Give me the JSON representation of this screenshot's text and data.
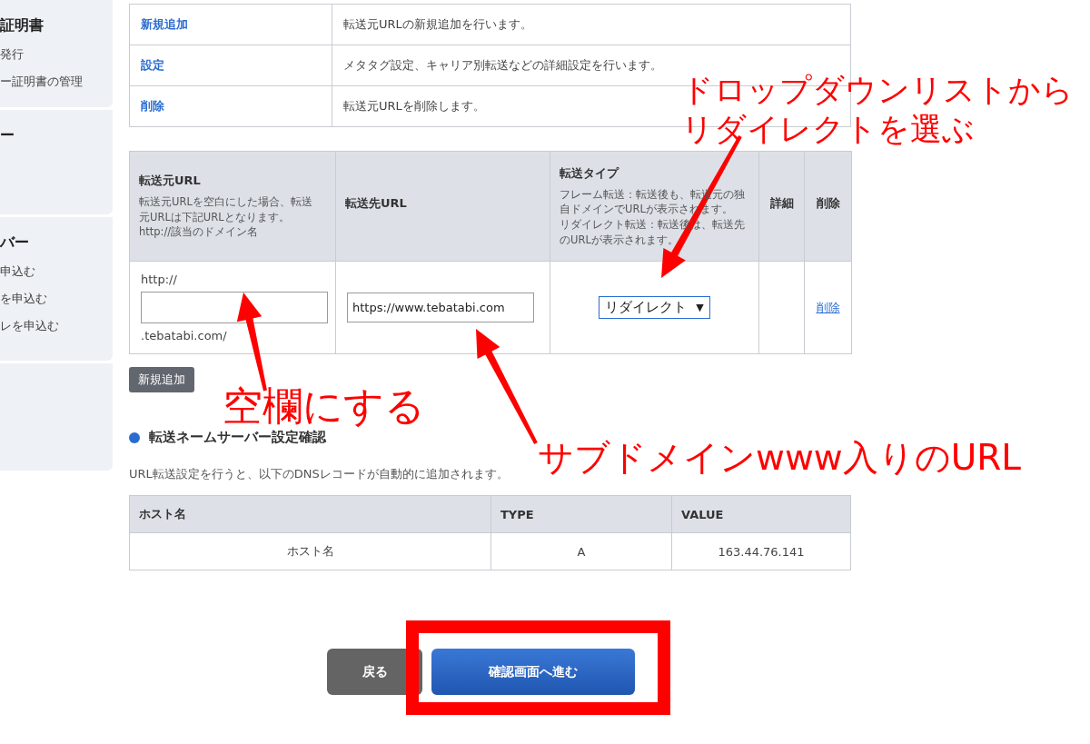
{
  "sidebar": {
    "cards": [
      {
        "title": "証明書",
        "items": [
          "発行",
          "ー証明書の管理"
        ]
      },
      {
        "title": "ー"
      },
      {
        "title": "バー",
        "items": [
          "申込む",
          "を申込む",
          "レを申込む"
        ]
      }
    ]
  },
  "action_table": {
    "rows": [
      {
        "action": "新規追加",
        "description": "転送元URLの新規追加を行います。"
      },
      {
        "action": "設定",
        "description": "メタタグ設定、キャリア別転送などの詳細設定を行います。"
      },
      {
        "action": "削除",
        "description": "転送元URLを削除します。"
      }
    ]
  },
  "forward_table": {
    "columns": [
      {
        "title": "転送元URL",
        "note": [
          "転送元URLを空白にした場合、転送",
          "元URLは下記URLとなります。",
          "http://該当のドメイン名"
        ]
      },
      {
        "title": "転送先URL"
      },
      {
        "title": "転送タイプ",
        "note": [
          "フレーム転送：転送後も、転送元の独",
          "自ドメインでURLが表示されます。",
          "リダイレクト転送：転送後は、転送先",
          "のURLが表示されます。"
        ]
      },
      {
        "title": "詳細"
      },
      {
        "title": "削除"
      }
    ],
    "rows": [
      {
        "prefix": "http://",
        "suffix": ".tebatabi.com/",
        "target_value": "https://www.tebatabi.com",
        "type": "リダイレクト",
        "type_arrow": "▼",
        "delete": "削除"
      }
    ]
  },
  "add_button": "新規追加",
  "dns_section": {
    "heading": "転送ネームサーバー設定確認",
    "description": "URL転送設定を行うと、以下のDNSレコードが自動的に追加されます。",
    "columns": [
      "ホスト名",
      "TYPE",
      "VALUE"
    ],
    "rows": [
      [
        "ホスト名",
        "A",
        "163.44.76.141"
      ]
    ]
  },
  "buttons": [
    {
      "label": "戻る",
      "kind": "back"
    },
    {
      "label": "確認画面へ進む",
      "kind": "primary"
    }
  ],
  "annotations": [
    {
      "lines": [
        "ドロップダウンリストから",
        "リダイレクトを選ぶ"
      ]
    },
    {
      "lines": [
        "空欄にする"
      ]
    },
    {
      "lines": [
        "サブドメインwww入りのURL"
      ]
    }
  ]
}
